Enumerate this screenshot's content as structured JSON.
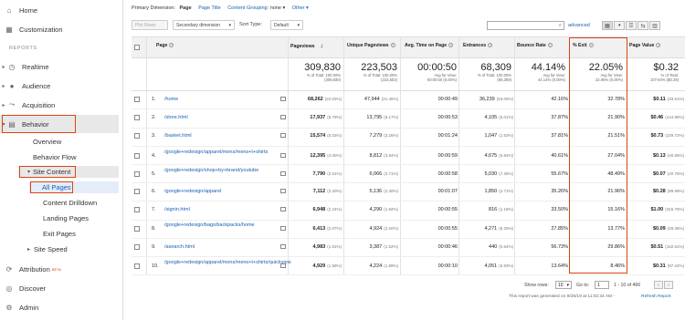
{
  "sidebar": {
    "home": "Home",
    "customization": "Customization",
    "section": "REPORTS",
    "realtime": "Realtime",
    "audience": "Audience",
    "acquisition": "Acquisition",
    "behavior": "Behavior",
    "overview": "Overview",
    "behavior_flow": "Behavior Flow",
    "site_content": "Site Content",
    "all_pages": "All Pages",
    "content_drilldown": "Content Drilldown",
    "landing_pages": "Landing Pages",
    "exit_pages": "Exit Pages",
    "site_speed": "Site Speed",
    "attribution": "Attribution",
    "attribution_badge": "BETA",
    "discover": "Discover",
    "admin": "Admin"
  },
  "dimension_bar": {
    "label": "Primary Dimension:",
    "active": "Page",
    "page_title": "Page Title",
    "grouping": "Content Grouping:",
    "grouping_value": "none",
    "other": "Other"
  },
  "toolbar": {
    "plot_rows": "Plot Rows",
    "secondary_dimension": "Secondary dimension",
    "sort_type_label": "Sort Type:",
    "sort_type_value": "Default",
    "advanced": "advanced"
  },
  "table": {
    "headers": {
      "page": "Page",
      "pageviews": "Pageviews",
      "unique": "Unique Pageviews",
      "avg_time": "Avg. Time on Page",
      "entrances": "Entrances",
      "bounce": "Bounce Rate",
      "exit": "% Exit",
      "value": "Page Value"
    },
    "totals": {
      "pageviews": "309,830",
      "pageviews_sub1": "% of Total: 100.00%",
      "pageviews_sub2": "(309,830)",
      "unique": "223,503",
      "unique_sub1": "% of Total: 100.00%",
      "unique_sub2": "(223,503)",
      "avg_time": "00:00:50",
      "avg_time_sub1": "Avg for View:",
      "avg_time_sub2": "00:00:50 (0.00%)",
      "entrances": "68,309",
      "entrances_sub1": "% of Total: 100.00%",
      "entrances_sub2": "(68,309)",
      "bounce": "44.14%",
      "bounce_sub1": "Avg for View:",
      "bounce_sub2": "44.14% (0.00%)",
      "exit": "22.05%",
      "exit_sub1": "Avg for View:",
      "exit_sub2": "22.05% (0.00%)",
      "value": "$0.32",
      "value_sub1": "% of Total:",
      "value_sub2": "107.94% ($0.29)"
    },
    "rows": [
      {
        "n": "1.",
        "page": "/home",
        "pv": "68,262",
        "pvp": "(22.03%)",
        "upv": "47,944",
        "upvp": "(21.45%)",
        "time": "00:00:49",
        "ent": "36,239",
        "entp": "(53.05%)",
        "bounce": "42.16%",
        "exit": "32.78%",
        "val": "$0.11",
        "valp": "(33.61%)"
      },
      {
        "n": "2.",
        "page": "/store.html",
        "pv": "17,937",
        "pvp": "(5.79%)",
        "upv": "13,795",
        "upvp": "(6.17%)",
        "time": "00:00:53",
        "ent": "4,105",
        "entp": "(6.01%)",
        "bounce": "37.87%",
        "exit": "21.90%",
        "val": "$0.46",
        "valp": "(144.96%)"
      },
      {
        "n": "3.",
        "page": "/basket.html",
        "pv": "15,574",
        "pvp": "(5.03%)",
        "upv": "7,279",
        "upvp": "(3.26%)",
        "time": "00:01:24",
        "ent": "1,047",
        "entp": "(1.53%)",
        "bounce": "37.81%",
        "exit": "21.51%",
        "val": "$0.73",
        "valp": "(229.72%)"
      },
      {
        "n": "4.",
        "page": "/google+redesign/apparel/mens/mens+t+shirts",
        "pv": "12,395",
        "pvp": "(4.00%)",
        "upv": "8,812",
        "upvp": "(3.94%)",
        "time": "00:00:59",
        "ent": "4,675",
        "entp": "(6.84%)",
        "bounce": "40.61%",
        "exit": "27.04%",
        "val": "$0.13",
        "valp": "(40.56%)"
      },
      {
        "n": "5.",
        "page": "/google+redesign/shop+by+brand/youtube",
        "pv": "7,790",
        "pvp": "(2.51%)",
        "upv": "6,066",
        "upvp": "(2.71%)",
        "time": "00:00:58",
        "ent": "5,030",
        "entp": "(7.36%)",
        "bounce": "55.67%",
        "exit": "48.49%",
        "val": "$0.07",
        "valp": "(20.76%)"
      },
      {
        "n": "6.",
        "page": "/google+redesign/apparel",
        "pv": "7,112",
        "pvp": "(2.30%)",
        "upv": "5,136",
        "upvp": "(2.30%)",
        "time": "00:01:07",
        "ent": "1,850",
        "entp": "(2.71%)",
        "bounce": "35.26%",
        "exit": "21.96%",
        "val": "$0.28",
        "valp": "(89.68%)"
      },
      {
        "n": "7.",
        "page": "/signin.html",
        "pv": "6,948",
        "pvp": "(2.24%)",
        "upv": "4,290",
        "upvp": "(1.92%)",
        "time": "00:00:55",
        "ent": "816",
        "entp": "(1.19%)",
        "bounce": "33.50%",
        "exit": "15.16%",
        "val": "$1.00",
        "valp": "(316.75%)"
      },
      {
        "n": "8.",
        "page": "/google+redesign/bags/backpacks/home",
        "pv": "6,413",
        "pvp": "(2.07%)",
        "upv": "4,924",
        "upvp": "(2.20%)",
        "time": "00:00:55",
        "ent": "4,271",
        "entp": "(6.25%)",
        "bounce": "27.85%",
        "exit": "13.77%",
        "val": "$0.09",
        "valp": "(29.35%)"
      },
      {
        "n": "9.",
        "page": "/asearch.html",
        "pv": "4,983",
        "pvp": "(1.61%)",
        "upv": "3,387",
        "upvp": "(1.52%)",
        "time": "00:00:46",
        "ent": "440",
        "entp": "(0.64%)",
        "bounce": "56.73%",
        "exit": "29.86%",
        "val": "$0.51",
        "valp": "(162.61%)"
      },
      {
        "n": "10.",
        "page": "/google+redesign/apparel/mens/mens+t+shirts/quickview",
        "pv": "4,929",
        "pvp": "(1.59%)",
        "upv": "4,224",
        "upvp": "(1.89%)",
        "time": "00:00:10",
        "ent": "4,051",
        "entp": "(5.93%)",
        "bounce": "13.64%",
        "exit": "8.46%",
        "val": "$0.31",
        "valp": "(97.24%)"
      }
    ]
  },
  "footer": {
    "show_rows_label": "Show rows:",
    "show_rows_value": "10",
    "goto_label": "Go to:",
    "goto_value": "1",
    "range": "1 - 10 of 466",
    "generated": "This report was generated on 9/25/19 at 11:02:34 AM -",
    "refresh": "Refresh Report"
  },
  "colors": {
    "accent": "#d9460f",
    "link": "#1a5fb4"
  }
}
